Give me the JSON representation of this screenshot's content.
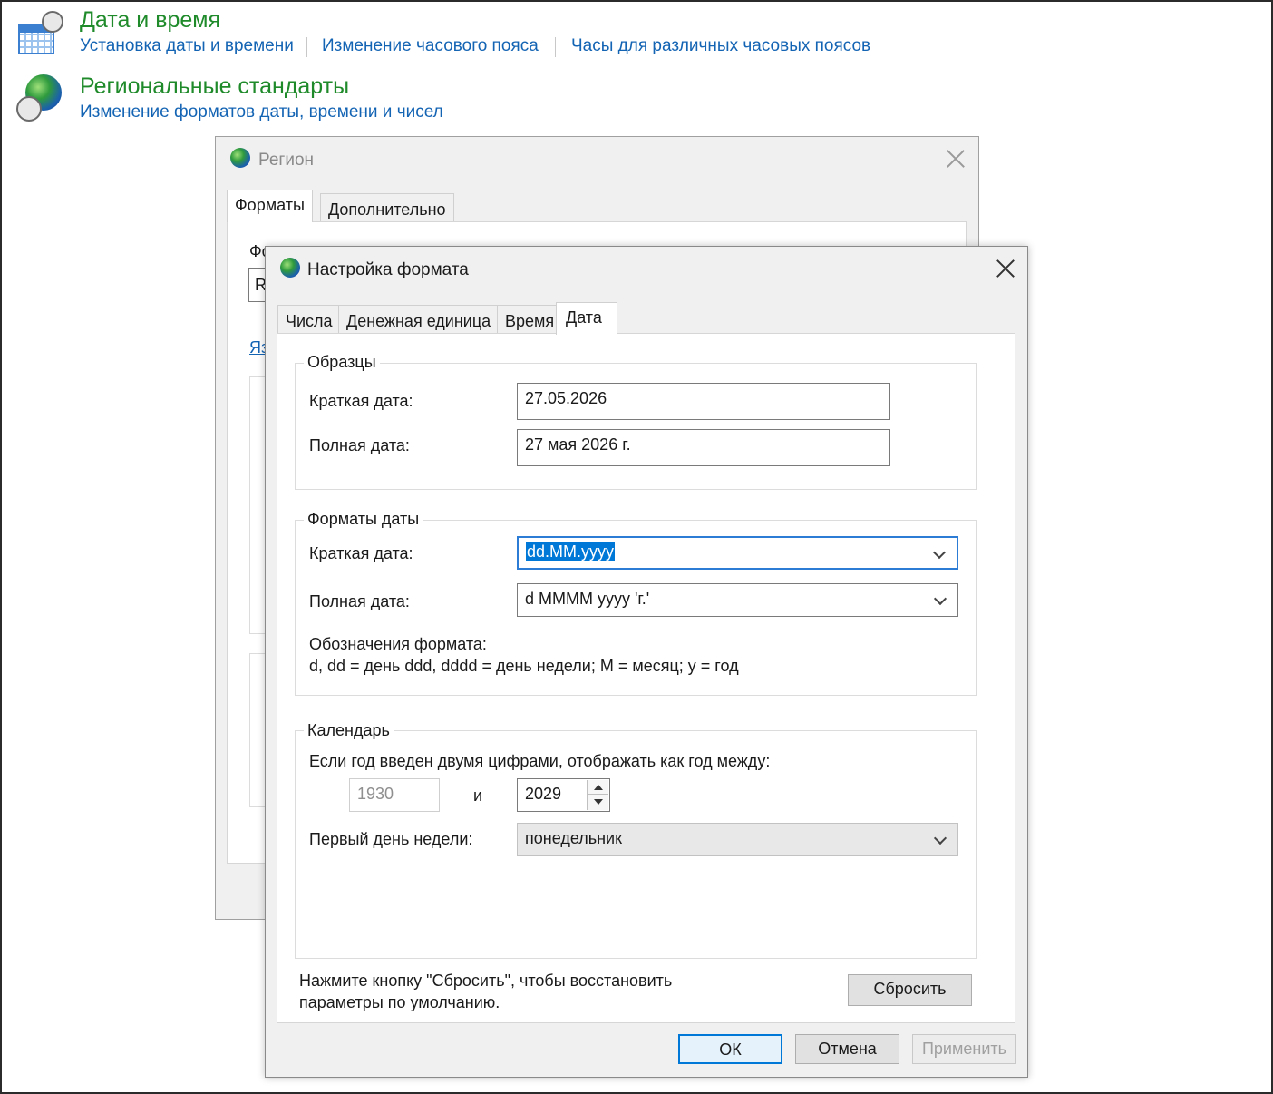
{
  "control_panel": {
    "date_time": {
      "title": "Дата и время",
      "links": [
        "Установка даты и времени",
        "Изменение часового пояса",
        "Часы для различных часовых поясов"
      ]
    },
    "regional": {
      "title": "Региональные стандарты",
      "link": "Изменение форматов даты, времени и чисел"
    }
  },
  "region_window": {
    "title": "Регион",
    "tabs": [
      "Форматы",
      "Дополнительно"
    ],
    "partial": {
      "format_label": "Фо",
      "combo_letter": "R",
      "lang_link": "Яз"
    }
  },
  "format_dialog": {
    "title": "Настройка формата",
    "tabs": [
      "Числа",
      "Денежная единица",
      "Время",
      "Дата"
    ],
    "active_tab": "Дата",
    "samples": {
      "legend": "Образцы",
      "short_label": "Краткая дата:",
      "short_value": "27.05.2026",
      "long_label": "Полная дата:",
      "long_value": "27 мая 2026 г."
    },
    "formats": {
      "legend": "Форматы даты",
      "short_label": "Краткая дата:",
      "short_value": "dd.MM.yyyy",
      "long_label": "Полная дата:",
      "long_value": "d MMMM yyyy 'г.'",
      "notation_title": "Обозначения формата:",
      "notation_text": "d, dd = день  ddd, dddd = день недели; M = месяц; y = год"
    },
    "calendar": {
      "legend": "Календарь",
      "two_digit_text": "Если год введен двумя цифрами, отображать как год между:",
      "year_from": "1930",
      "and_label": "и",
      "year_to": "2029",
      "first_day_label": "Первый день недели:",
      "first_day_value": "понедельник"
    },
    "reset_text_line1": "Нажмите кнопку \"Сбросить\", чтобы восстановить",
    "reset_text_line2": "параметры по умолчанию.",
    "reset_button": "Сбросить",
    "buttons": {
      "ok": "ОК",
      "cancel": "Отмена",
      "apply": "Применить"
    }
  }
}
